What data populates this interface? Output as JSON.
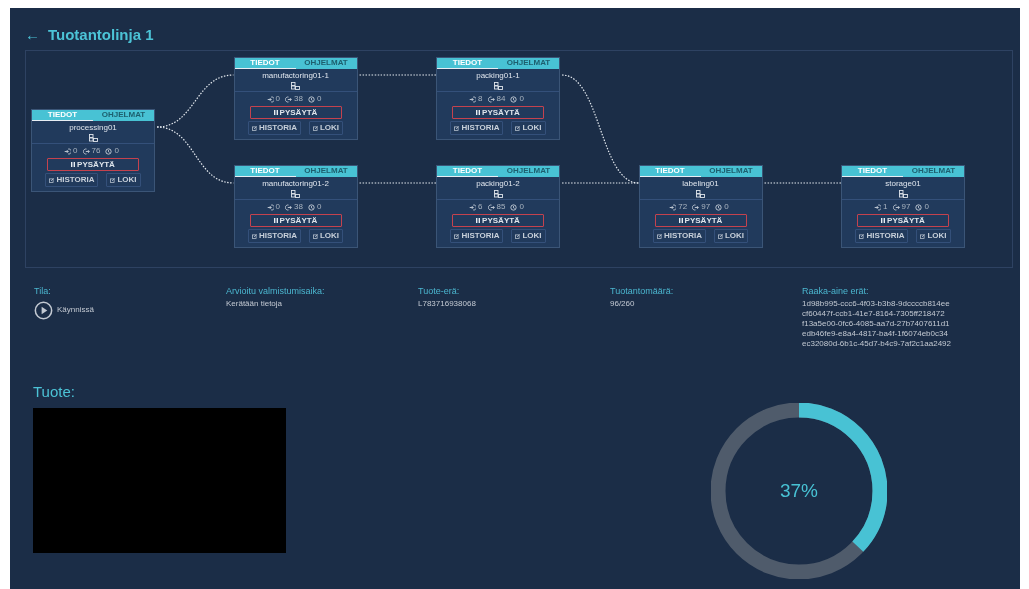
{
  "header": {
    "back": "←",
    "title": "Tuotantolinja 1"
  },
  "stages": [
    {
      "nodes": [
        {
          "name": "processing01",
          "tabs": [
            {
              "label": "TIEDOT",
              "selected": true
            },
            {
              "label": "OHJELMAT",
              "selected": false
            }
          ],
          "counts": [
            "0",
            "76",
            "0"
          ],
          "pause": "PYSÄYTÄ",
          "history": "HISTORIA",
          "log": "LOKI"
        }
      ]
    },
    {
      "nodes": [
        {
          "name": "manufactoring01-1",
          "tabs": [
            {
              "label": "TIEDOT",
              "selected": true
            },
            {
              "label": "OHJELMAT",
              "selected": false
            }
          ],
          "counts": [
            "0",
            "38",
            "0"
          ],
          "pause": "PYSÄYTÄ",
          "history": "HISTORIA",
          "log": "LOKI"
        },
        {
          "name": "manufactoring01-2",
          "tabs": [
            {
              "label": "TIEDOT",
              "selected": true
            },
            {
              "label": "OHJELMAT",
              "selected": false
            }
          ],
          "counts": [
            "0",
            "38",
            "0"
          ],
          "pause": "PYSÄYTÄ",
          "history": "HISTORIA",
          "log": "LOKI"
        }
      ]
    },
    {
      "nodes": [
        {
          "name": "packing01-1",
          "tabs": [
            {
              "label": "TIEDOT",
              "selected": true
            },
            {
              "label": "OHJELMAT",
              "selected": false
            }
          ],
          "counts": [
            "8",
            "84",
            "0"
          ],
          "pause": "PYSÄYTÄ",
          "history": "HISTORIA",
          "log": "LOKI"
        },
        {
          "name": "packing01-2",
          "tabs": [
            {
              "label": "TIEDOT",
              "selected": true
            },
            {
              "label": "OHJELMAT",
              "selected": false
            }
          ],
          "counts": [
            "6",
            "85",
            "0"
          ],
          "pause": "PYSÄYTÄ",
          "history": "HISTORIA",
          "log": "LOKI"
        }
      ]
    },
    {
      "nodes": [
        {
          "name": "labeling01",
          "tabs": [
            {
              "label": "TIEDOT",
              "selected": true
            },
            {
              "label": "OHJELMAT",
              "selected": false
            }
          ],
          "counts": [
            "72",
            "97",
            "0"
          ],
          "pause": "PYSÄYTÄ",
          "history": "HISTORIA",
          "log": "LOKI"
        }
      ]
    },
    {
      "nodes": [
        {
          "name": "storage01",
          "tabs": [
            {
              "label": "TIEDOT",
              "selected": true
            },
            {
              "label": "OHJELMAT",
              "selected": false
            }
          ],
          "counts": [
            "1",
            "97",
            "0"
          ],
          "pause": "PYSÄYTÄ",
          "history": "HISTORIA",
          "log": "LOKI"
        }
      ]
    }
  ],
  "info": [
    {
      "kind": "status",
      "label": "Tila:",
      "values": [
        "Käynnissä"
      ]
    },
    {
      "kind": "text",
      "label": "Arvioitu valmistumisaika:",
      "values": [
        "Kerätään tietoja"
      ]
    },
    {
      "kind": "text",
      "label": "Tuote-erä:",
      "values": [
        "L783716938068"
      ]
    },
    {
      "kind": "text",
      "label": "Tuotantomäärä:",
      "values": [
        "96/260"
      ]
    },
    {
      "kind": "text",
      "label": "Raaka-aine erät:",
      "values": [
        "1d98b995-ccc6-4f03-b3b8-9dccccb814ee",
        "cf60447f-ccb1-41e7-8164-7305ff218472",
        "f13a5e00-0fc6-4085-aa7d-27b7407611d1",
        "edb46fe9-e8a4-4817-ba4f-1f6074eb0c34",
        "ec32080d-6b1c-45d7-b4c9-7af2c1aa2492"
      ]
    }
  ],
  "product": {
    "title": "Tuote:"
  },
  "progress": {
    "level": 0.37,
    "label": "37%"
  }
}
